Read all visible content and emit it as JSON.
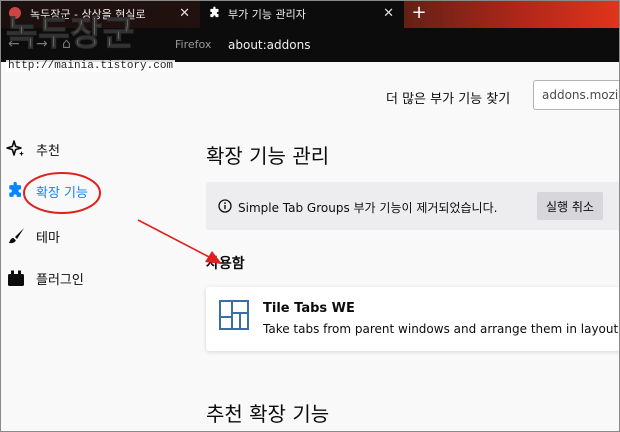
{
  "watermark": {
    "title": "녹두장군",
    "url": "http://mainia.tistory.com"
  },
  "tabs": [
    {
      "label": "녹두장군 - 상상을 현실로",
      "active": false
    },
    {
      "label": "부가 기능 관리자",
      "active": true
    }
  ],
  "navbar": {
    "brand": "Firefox",
    "url": "about:addons"
  },
  "search": {
    "label": "더 많은 부가 기능 찾기",
    "value": "addons.mozi"
  },
  "sidebar": {
    "items": [
      {
        "label": "추천",
        "icon": "sparkle-icon",
        "active": false
      },
      {
        "label": "확장 기능",
        "icon": "puzzle-icon",
        "active": true
      },
      {
        "label": "테마",
        "icon": "brush-icon",
        "active": false
      },
      {
        "label": "플러그인",
        "icon": "plugin-icon",
        "active": false
      }
    ]
  },
  "main": {
    "heading": "확장 기능 관리",
    "notice": {
      "message": "Simple Tab Groups 부가 기능이 제거되었습니다.",
      "undo_label": "실행 취소"
    },
    "enabled_heading": "사용함",
    "addon": {
      "name": "Tile Tabs WE",
      "description": "Take tabs from parent windows and arrange them in layouts o"
    },
    "recommended_heading": "추천 확장 기능"
  },
  "colors": {
    "accent": "#0a84ff",
    "annotation": "#e0201c",
    "notice_bg": "#ededf0"
  }
}
